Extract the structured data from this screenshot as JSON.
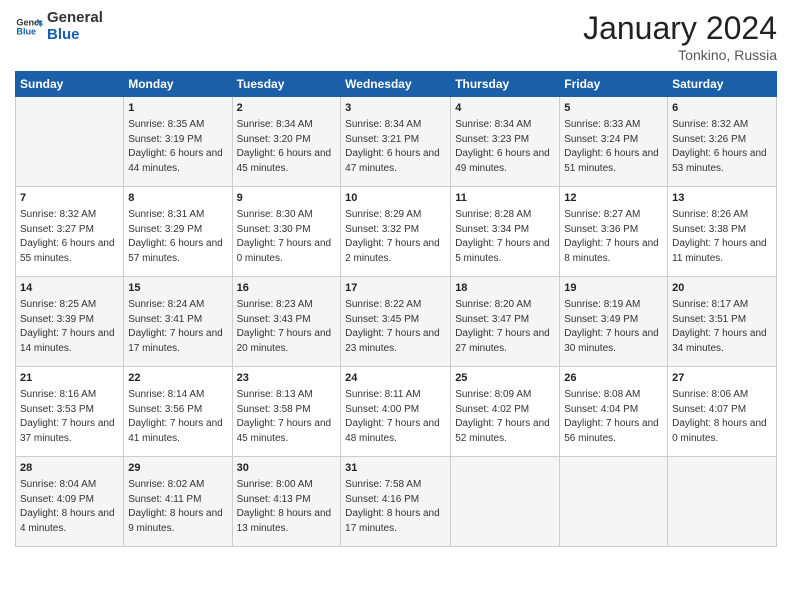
{
  "header": {
    "logo_text_general": "General",
    "logo_text_blue": "Blue",
    "month": "January 2024",
    "location": "Tonkino, Russia"
  },
  "weekdays": [
    "Sunday",
    "Monday",
    "Tuesday",
    "Wednesday",
    "Thursday",
    "Friday",
    "Saturday"
  ],
  "weeks": [
    [
      {
        "day": "",
        "detail": ""
      },
      {
        "day": "1",
        "detail": "Sunrise: 8:35 AM\nSunset: 3:19 PM\nDaylight: 6 hours\nand 44 minutes."
      },
      {
        "day": "2",
        "detail": "Sunrise: 8:34 AM\nSunset: 3:20 PM\nDaylight: 6 hours\nand 45 minutes."
      },
      {
        "day": "3",
        "detail": "Sunrise: 8:34 AM\nSunset: 3:21 PM\nDaylight: 6 hours\nand 47 minutes."
      },
      {
        "day": "4",
        "detail": "Sunrise: 8:34 AM\nSunset: 3:23 PM\nDaylight: 6 hours\nand 49 minutes."
      },
      {
        "day": "5",
        "detail": "Sunrise: 8:33 AM\nSunset: 3:24 PM\nDaylight: 6 hours\nand 51 minutes."
      },
      {
        "day": "6",
        "detail": "Sunrise: 8:32 AM\nSunset: 3:26 PM\nDaylight: 6 hours\nand 53 minutes."
      }
    ],
    [
      {
        "day": "7",
        "detail": "Sunrise: 8:32 AM\nSunset: 3:27 PM\nDaylight: 6 hours\nand 55 minutes."
      },
      {
        "day": "8",
        "detail": "Sunrise: 8:31 AM\nSunset: 3:29 PM\nDaylight: 6 hours\nand 57 minutes."
      },
      {
        "day": "9",
        "detail": "Sunrise: 8:30 AM\nSunset: 3:30 PM\nDaylight: 7 hours\nand 0 minutes."
      },
      {
        "day": "10",
        "detail": "Sunrise: 8:29 AM\nSunset: 3:32 PM\nDaylight: 7 hours\nand 2 minutes."
      },
      {
        "day": "11",
        "detail": "Sunrise: 8:28 AM\nSunset: 3:34 PM\nDaylight: 7 hours\nand 5 minutes."
      },
      {
        "day": "12",
        "detail": "Sunrise: 8:27 AM\nSunset: 3:36 PM\nDaylight: 7 hours\nand 8 minutes."
      },
      {
        "day": "13",
        "detail": "Sunrise: 8:26 AM\nSunset: 3:38 PM\nDaylight: 7 hours\nand 11 minutes."
      }
    ],
    [
      {
        "day": "14",
        "detail": "Sunrise: 8:25 AM\nSunset: 3:39 PM\nDaylight: 7 hours\nand 14 minutes."
      },
      {
        "day": "15",
        "detail": "Sunrise: 8:24 AM\nSunset: 3:41 PM\nDaylight: 7 hours\nand 17 minutes."
      },
      {
        "day": "16",
        "detail": "Sunrise: 8:23 AM\nSunset: 3:43 PM\nDaylight: 7 hours\nand 20 minutes."
      },
      {
        "day": "17",
        "detail": "Sunrise: 8:22 AM\nSunset: 3:45 PM\nDaylight: 7 hours\nand 23 minutes."
      },
      {
        "day": "18",
        "detail": "Sunrise: 8:20 AM\nSunset: 3:47 PM\nDaylight: 7 hours\nand 27 minutes."
      },
      {
        "day": "19",
        "detail": "Sunrise: 8:19 AM\nSunset: 3:49 PM\nDaylight: 7 hours\nand 30 minutes."
      },
      {
        "day": "20",
        "detail": "Sunrise: 8:17 AM\nSunset: 3:51 PM\nDaylight: 7 hours\nand 34 minutes."
      }
    ],
    [
      {
        "day": "21",
        "detail": "Sunrise: 8:16 AM\nSunset: 3:53 PM\nDaylight: 7 hours\nand 37 minutes."
      },
      {
        "day": "22",
        "detail": "Sunrise: 8:14 AM\nSunset: 3:56 PM\nDaylight: 7 hours\nand 41 minutes."
      },
      {
        "day": "23",
        "detail": "Sunrise: 8:13 AM\nSunset: 3:58 PM\nDaylight: 7 hours\nand 45 minutes."
      },
      {
        "day": "24",
        "detail": "Sunrise: 8:11 AM\nSunset: 4:00 PM\nDaylight: 7 hours\nand 48 minutes."
      },
      {
        "day": "25",
        "detail": "Sunrise: 8:09 AM\nSunset: 4:02 PM\nDaylight: 7 hours\nand 52 minutes."
      },
      {
        "day": "26",
        "detail": "Sunrise: 8:08 AM\nSunset: 4:04 PM\nDaylight: 7 hours\nand 56 minutes."
      },
      {
        "day": "27",
        "detail": "Sunrise: 8:06 AM\nSunset: 4:07 PM\nDaylight: 8 hours\nand 0 minutes."
      }
    ],
    [
      {
        "day": "28",
        "detail": "Sunrise: 8:04 AM\nSunset: 4:09 PM\nDaylight: 8 hours\nand 4 minutes."
      },
      {
        "day": "29",
        "detail": "Sunrise: 8:02 AM\nSunset: 4:11 PM\nDaylight: 8 hours\nand 9 minutes."
      },
      {
        "day": "30",
        "detail": "Sunrise: 8:00 AM\nSunset: 4:13 PM\nDaylight: 8 hours\nand 13 minutes."
      },
      {
        "day": "31",
        "detail": "Sunrise: 7:58 AM\nSunset: 4:16 PM\nDaylight: 8 hours\nand 17 minutes."
      },
      {
        "day": "",
        "detail": ""
      },
      {
        "day": "",
        "detail": ""
      },
      {
        "day": "",
        "detail": ""
      }
    ]
  ]
}
